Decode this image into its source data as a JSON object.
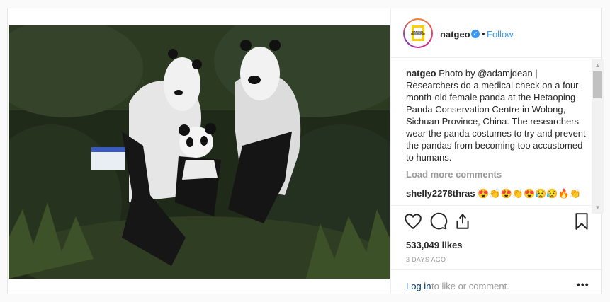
{
  "post": {
    "username": "natgeo",
    "follow_label": "Follow",
    "dot": "•",
    "logo_text": "NATIONAL GEOGRAPHIC",
    "caption_user": "natgeo",
    "caption": "Photo by @adamjdean | Researchers do a medical check on a four-month-old female panda at the Hetaoping Panda Conservation Centre in Wolong, Sichuan Province, China. The researchers wear the panda costumes to try and prevent the pandas from becoming too accustomed to humans.",
    "load_more": "Load more comments",
    "comments": [
      {
        "user": "shelly2278thras",
        "text": "😍👏😍👏😍😥😥🔥👏"
      }
    ],
    "likes": "533,049 likes",
    "timestamp": "3 DAYS AGO",
    "login_link": "Log in",
    "login_rest": "to like or comment.",
    "more_label": "•••"
  },
  "icons": {
    "like": "heart-icon",
    "comment": "comment-icon",
    "share": "share-icon",
    "save": "bookmark-icon",
    "verified": "verified-badge-icon"
  },
  "colors": {
    "link": "#3897f0",
    "login": "#003569",
    "muted": "#999999",
    "border": "#efefef"
  }
}
